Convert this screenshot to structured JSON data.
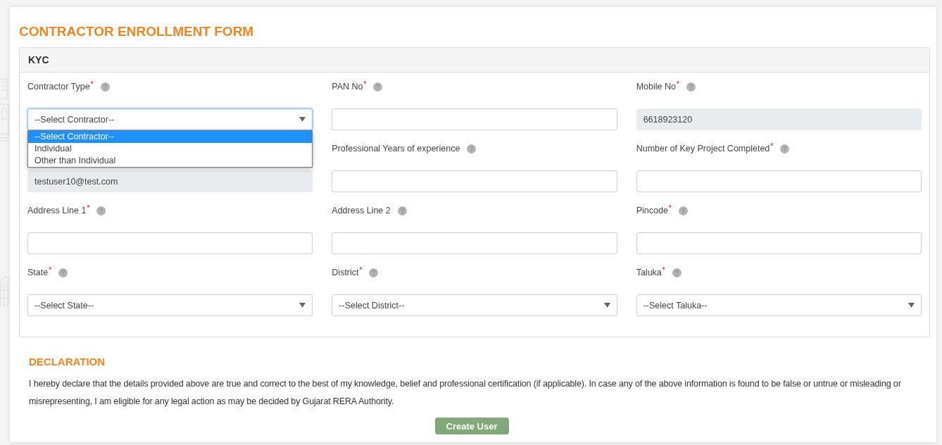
{
  "page": {
    "title": "CONTRACTOR ENROLLMENT FORM"
  },
  "kyc": {
    "heading": "KYC",
    "fields": [
      {
        "kind": "select",
        "label": "Contractor Type",
        "required_mark": "*",
        "value": "--Select Contractor--",
        "disabled": false,
        "expanded": true,
        "options": [
          {
            "label": "--Select Contractor--",
            "selected": true
          },
          {
            "label": "Individual",
            "selected": false
          },
          {
            "label": "Other than Individual",
            "selected": false
          }
        ]
      },
      {
        "kind": "input",
        "label": "PAN No",
        "required_mark": "*",
        "disabled": false
      },
      {
        "kind": "input",
        "label": "Mobile No",
        "required_mark": "*",
        "value": "6618923120",
        "disabled": true
      },
      {
        "kind": "input",
        "value": "testuser10@test.com",
        "disabled": true
      },
      {
        "kind": "input",
        "label": "Professional Years of experience",
        "disabled": false
      },
      {
        "kind": "input",
        "label": "Number of Key Project Completed",
        "required_mark": "*",
        "disabled": false
      },
      {
        "kind": "input",
        "label": "Address Line 1",
        "required_mark": "*",
        "disabled": false
      },
      {
        "kind": "input",
        "label": "Address Line 2",
        "disabled": false
      },
      {
        "kind": "input",
        "label": "Pincode",
        "required_mark": "*",
        "disabled": false
      },
      {
        "kind": "select",
        "label": "State",
        "required_mark": "*",
        "value": "--Select State--",
        "disabled": false,
        "expanded": false
      },
      {
        "kind": "select",
        "label": "District",
        "required_mark": "*",
        "value": "--Select District--",
        "disabled": false,
        "expanded": false
      },
      {
        "kind": "select",
        "label": "Taluka",
        "required_mark": "*",
        "value": "--Select Taluka--",
        "disabled": false,
        "expanded": false
      }
    ]
  },
  "declaration": {
    "heading": "DECLARATION",
    "text": "I hereby declare that the details provided above are true and correct to the best of my knowledge, belief and professional certification (if applicable). In case any of the above information is found to be false or untrue or misleading or misrepresenting, I am eligible for any legal action as may be decided by Gujarat RERA Authority.",
    "button": "Create User"
  }
}
